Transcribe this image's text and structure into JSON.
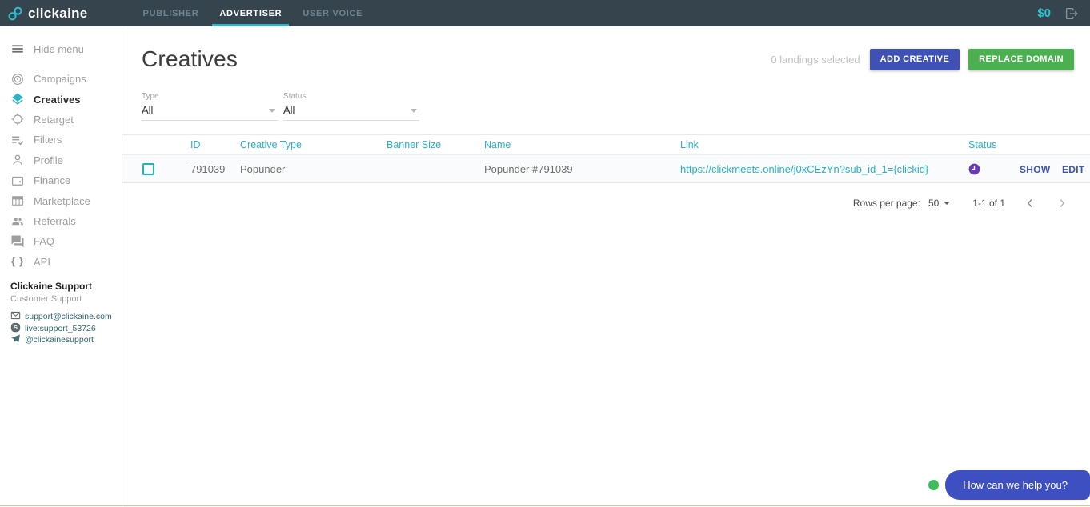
{
  "navbar": {
    "brand": "clickaine",
    "tabs": [
      {
        "label": "PUBLISHER",
        "active": false
      },
      {
        "label": "ADVERTISER",
        "active": true
      },
      {
        "label": "USER VOICE",
        "active": false
      }
    ],
    "balance": "$0"
  },
  "sidebar": {
    "hide_menu_label": "Hide menu",
    "items": [
      {
        "label": "Campaigns",
        "icon": "target-icon",
        "active": false
      },
      {
        "label": "Creatives",
        "icon": "layers-icon",
        "active": true
      },
      {
        "label": "Retarget",
        "icon": "crosshair-icon",
        "active": false
      },
      {
        "label": "Filters",
        "icon": "filter-check-icon",
        "active": false
      },
      {
        "label": "Profile",
        "icon": "person-icon",
        "active": false
      },
      {
        "label": "Finance",
        "icon": "wallet-icon",
        "active": false
      },
      {
        "label": "Marketplace",
        "icon": "grid-icon",
        "active": false
      },
      {
        "label": "Referrals",
        "icon": "people-icon",
        "active": false
      },
      {
        "label": "FAQ",
        "icon": "chat-icon",
        "active": false
      },
      {
        "label": "API",
        "icon": "braces-icon",
        "active": false
      }
    ],
    "support": {
      "title": "Clickaine Support",
      "subtitle": "Customer Support",
      "contacts": [
        {
          "icon": "email-icon",
          "label": "support@clickaine.com"
        },
        {
          "icon": "skype-icon",
          "label": "live:support_53726"
        },
        {
          "icon": "telegram-icon",
          "label": "@clickainesupport"
        }
      ]
    }
  },
  "main": {
    "title": "Creatives",
    "selection_status": "0 landings selected",
    "add_creative_label": "ADD CREATIVE",
    "replace_domain_label": "REPLACE DOMAIN",
    "filters": [
      {
        "label": "Type",
        "value": "All"
      },
      {
        "label": "Status",
        "value": "All"
      }
    ],
    "table": {
      "headers": [
        "ID",
        "Creative Type",
        "Banner Size",
        "Name",
        "Link",
        "Status"
      ],
      "rows": [
        {
          "id": "791039",
          "creative_type": "Popunder",
          "banner_size": "",
          "name": "Popunder #791039",
          "link": "https://clickmeets.online/j0xCEzYn?sub_id_1={clickid}",
          "status": "pending-clock",
          "show_label": "SHOW",
          "edit_label": "EDIT"
        }
      ]
    },
    "pagination": {
      "rows_per_page_label": "Rows per page:",
      "rows_per_page_value": "50",
      "range_label": "1-1 of 1"
    }
  },
  "chat": {
    "label": "How can we help you?"
  },
  "colors": {
    "navbar_bg": "#35444d",
    "teal_accent": "#2bb6c9",
    "indigo": "#3f51b5",
    "green": "#4caf50",
    "status_purple": "#6a3ab2",
    "chat_blue": "#3e4fc1"
  },
  "icons": {
    "logo": "infinity-link",
    "navbar_right": "logout",
    "sidebar": [
      "hamburger",
      "target",
      "layers",
      "crosshair",
      "filter-check",
      "person",
      "wallet",
      "grid",
      "people",
      "chat",
      "braces"
    ],
    "contacts": [
      "email",
      "skype",
      "telegram"
    ],
    "row_status": "clock",
    "pagination": [
      "chevron-left",
      "chevron-right"
    ]
  }
}
